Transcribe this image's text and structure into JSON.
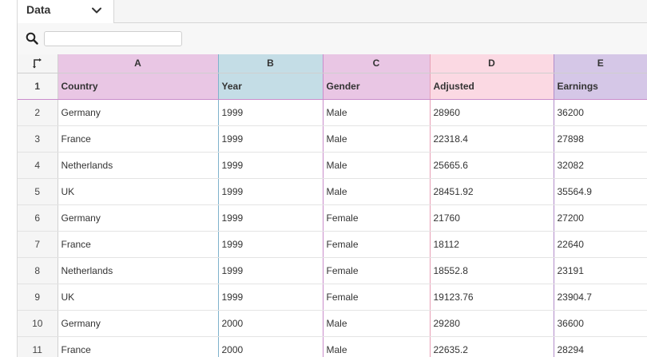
{
  "tab": {
    "label": "Data"
  },
  "search": {
    "value": "",
    "placeholder": ""
  },
  "columns": [
    "A",
    "B",
    "C",
    "D",
    "E"
  ],
  "rows": [
    {
      "num": "1",
      "cells": [
        "Country",
        "Year",
        "Gender",
        "Adjusted",
        "Earnings"
      ]
    },
    {
      "num": "2",
      "cells": [
        "Germany",
        "1999",
        "Male",
        "28960",
        "36200"
      ]
    },
    {
      "num": "3",
      "cells": [
        "France",
        "1999",
        "Male",
        "22318.4",
        "27898"
      ]
    },
    {
      "num": "4",
      "cells": [
        "Netherlands",
        "1999",
        "Male",
        "25665.6",
        "32082"
      ]
    },
    {
      "num": "5",
      "cells": [
        "UK",
        "1999",
        "Male",
        "28451.92",
        "35564.9"
      ]
    },
    {
      "num": "6",
      "cells": [
        "Germany",
        "1999",
        "Female",
        "21760",
        "27200"
      ]
    },
    {
      "num": "7",
      "cells": [
        "France",
        "1999",
        "Female",
        "18112",
        "22640"
      ]
    },
    {
      "num": "8",
      "cells": [
        "Netherlands",
        "1999",
        "Female",
        "18552.8",
        "23191"
      ]
    },
    {
      "num": "9",
      "cells": [
        "UK",
        "1999",
        "Female",
        "19123.76",
        "23904.7"
      ]
    },
    {
      "num": "10",
      "cells": [
        "Germany",
        "2000",
        "Male",
        "29280",
        "36600"
      ]
    },
    {
      "num": "11",
      "cells": [
        "France",
        "2000",
        "Male",
        "22635.2",
        "28294"
      ]
    }
  ],
  "colors": {
    "col_A": "#e9c6e4",
    "col_B": "#c4dde6",
    "col_C": "#e9c6e4",
    "col_D": "#fbd9e3",
    "col_E": "#d5c7e7"
  }
}
